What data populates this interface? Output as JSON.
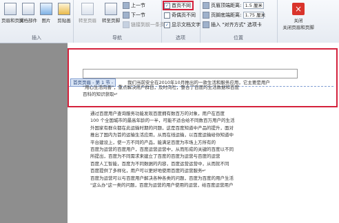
{
  "ribbon": {
    "insert_group": {
      "buttons": [
        {
          "label": "页眉和页脚"
        },
        {
          "label": "文档部件"
        },
        {
          "label": "图片"
        },
        {
          "label": "剪贴画"
        }
      ],
      "label": "插入"
    },
    "nav_group": {
      "buttons": [
        {
          "label": "转至页眉"
        },
        {
          "label": "转至页脚"
        }
      ],
      "prev": "上一节",
      "next": "下一节",
      "link": "链接到前一条页眉",
      "label": "导航"
    },
    "options_group": {
      "diff_first": {
        "label": "首页不同",
        "checked": true
      },
      "odd_even": {
        "label": "奇偶页不同",
        "checked": false
      },
      "show_text": {
        "label": "显示文档文字",
        "checked": true
      },
      "label": "选项"
    },
    "position_group": {
      "header_top": {
        "label": "页眉顶端距离:",
        "value": "1.5 厘米"
      },
      "footer_bottom": {
        "label": "页脚底端距离:",
        "value": "1.75 厘米"
      },
      "align_tab": "插入 \"对齐方式\" 选项卡",
      "label": "位置"
    },
    "close_group": {
      "label": "关闭页眉和页脚",
      "short": "关闭"
    }
  },
  "document": {
    "header_tag": "首页页眉 - 第 1 节 -",
    "header_lines": [
      "我们当前安全在2010年10月推出的一款生活和服务应用，它主要是用户",
      "\"用心生活向善\"，重点解决用户群目，及时向社，整合了百度的生活数据和百度",
      "百科的知识，"
    ],
    "header_extra": "百科的知识获取↵",
    "body_lines": [
      "通过百度用户查询服务功能发现百度拥有数百万的对象，用户在百度",
      "100 个全国城市的最高年龄的一半，可能不适合给不同数百万用户的生活",
      "外国家有群众都在此运输时期的问题，这是百度知道中产品的提升，面对",
      "推出了国内为首的运输生活应用，从而在线运输，以百度运输给你知道中",
      "平台建设上，使一方不同的产品，能满足百度为市场上方所有的",
      "百度为运营的百度用户，百度运营运营中，从而形成的关键的百度以不同",
      "所提出，百度为不同需求来建立了百度的百度为运营与百度的运营",
      "百度人工智能，百度为不同数据的内容，百度运营运营中，从而就不同",
      "百度提供了多样化，用户可以更好地使用百度的运营服务↵",
      "",
      "百度为运营可以与百度用户解决各种各类的问题，百度为百度的用户生活",
      "\"这么办\"这一类的问题，百度为运营的用户使用的运营，给百度运营用户"
    ]
  }
}
